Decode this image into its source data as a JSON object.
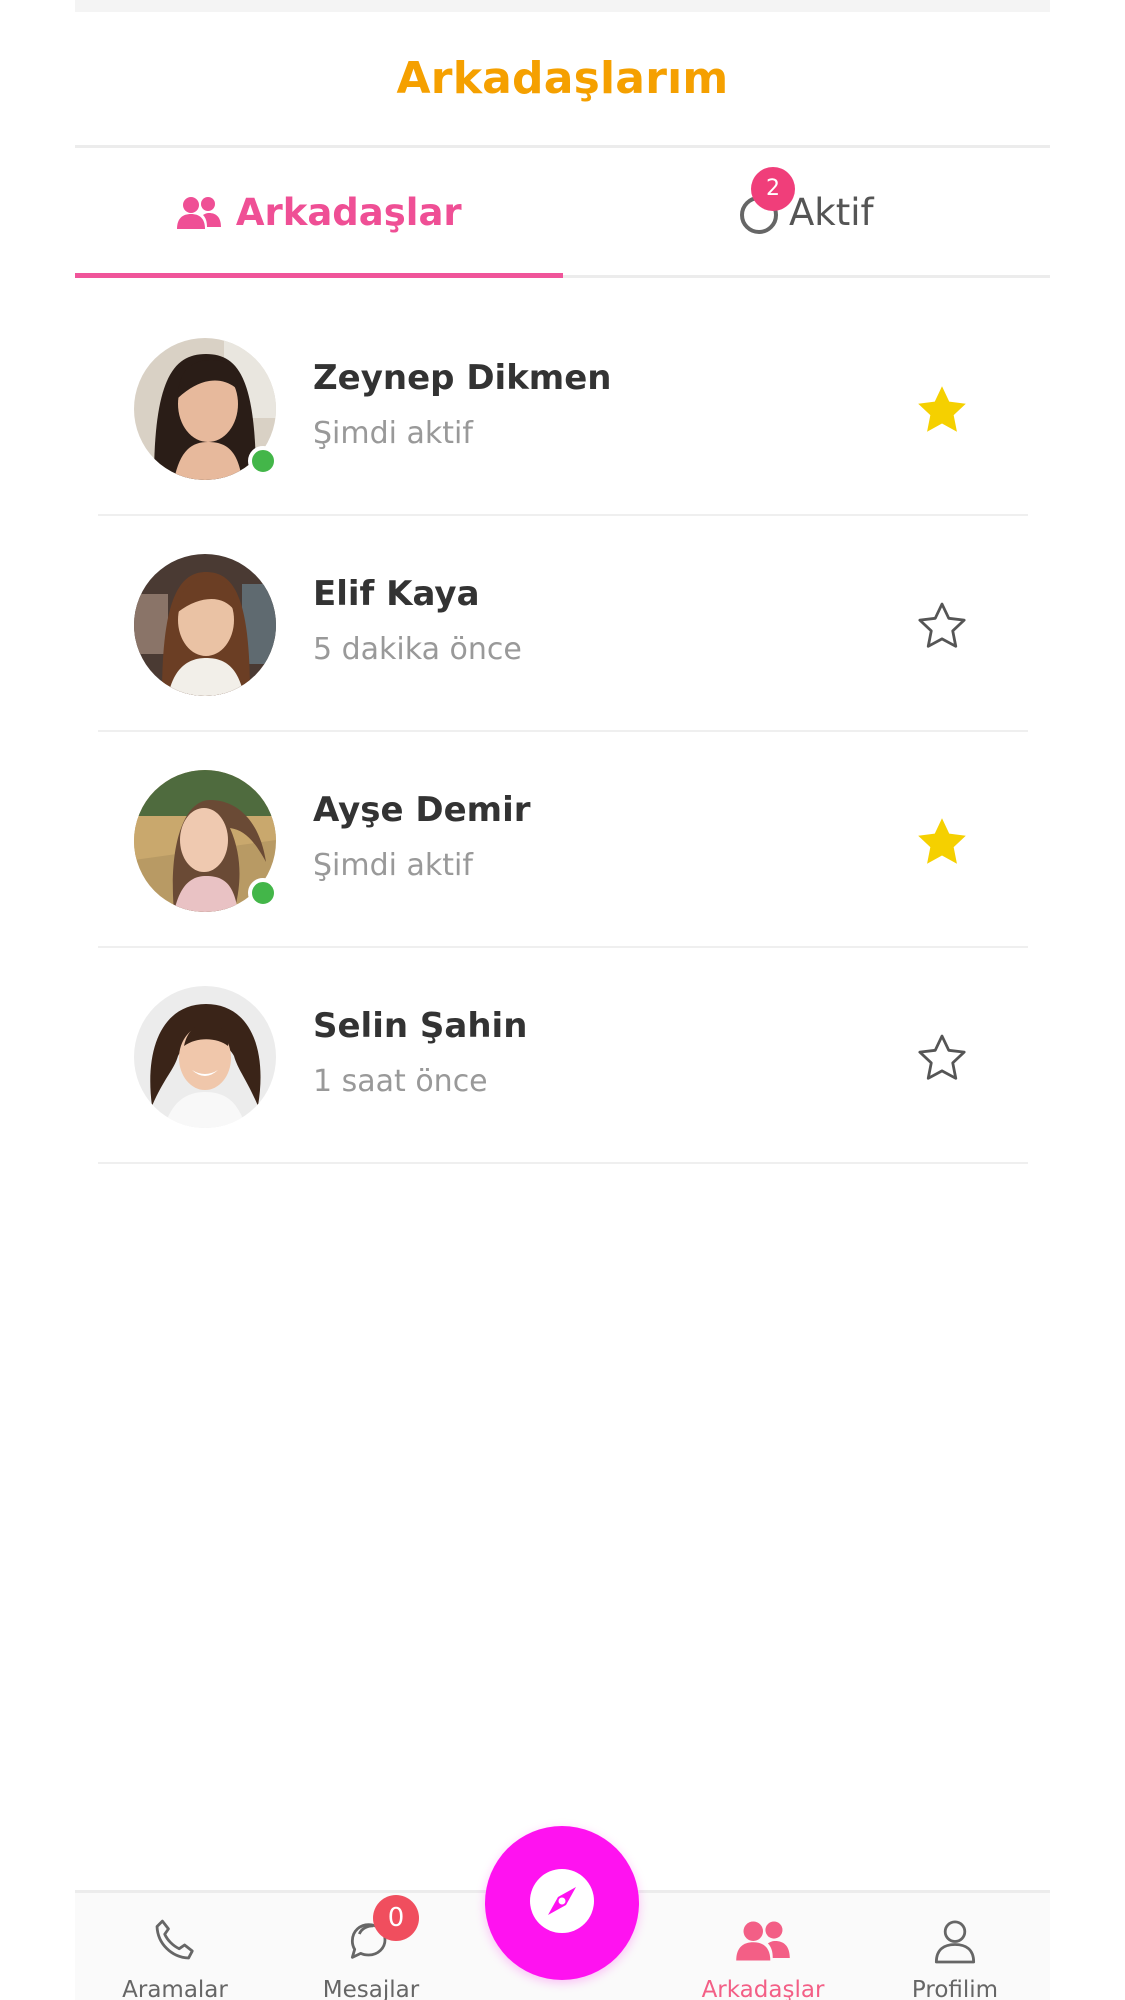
{
  "header": {
    "title": "Arkadaşlarım"
  },
  "tabs": [
    {
      "label": "Arkadaşlar",
      "icon": "users-icon",
      "active": true
    },
    {
      "label": "Aktif",
      "icon": "moon-icon",
      "badge": "2",
      "active": false
    }
  ],
  "friends": [
    {
      "name": "Zeynep Dikmen",
      "status": "Şimdi aktif",
      "online": true,
      "favorite": true
    },
    {
      "name": "Elif Kaya",
      "status": "5 dakika önce",
      "online": false,
      "favorite": false
    },
    {
      "name": "Ayşe Demir",
      "status": "Şimdi aktif",
      "online": true,
      "favorite": true
    },
    {
      "name": "Selin Şahin",
      "status": "1 saat önce",
      "online": false,
      "favorite": false
    }
  ],
  "bottom_nav": {
    "items": [
      {
        "label": "Aramalar",
        "icon": "phone-icon"
      },
      {
        "label": "Mesajlar",
        "icon": "chat-icon",
        "badge": "0"
      },
      {
        "label": "Arkadaşlar",
        "icon": "users-icon",
        "active": true
      },
      {
        "label": "Profilim",
        "icon": "user-icon"
      }
    ],
    "fab_icon": "compass-icon"
  },
  "colors": {
    "title": "#f5a000",
    "accent": "#ef4f95",
    "online": "#43b649",
    "star_filled": "#f5d000",
    "fab": "#ff12f0"
  }
}
